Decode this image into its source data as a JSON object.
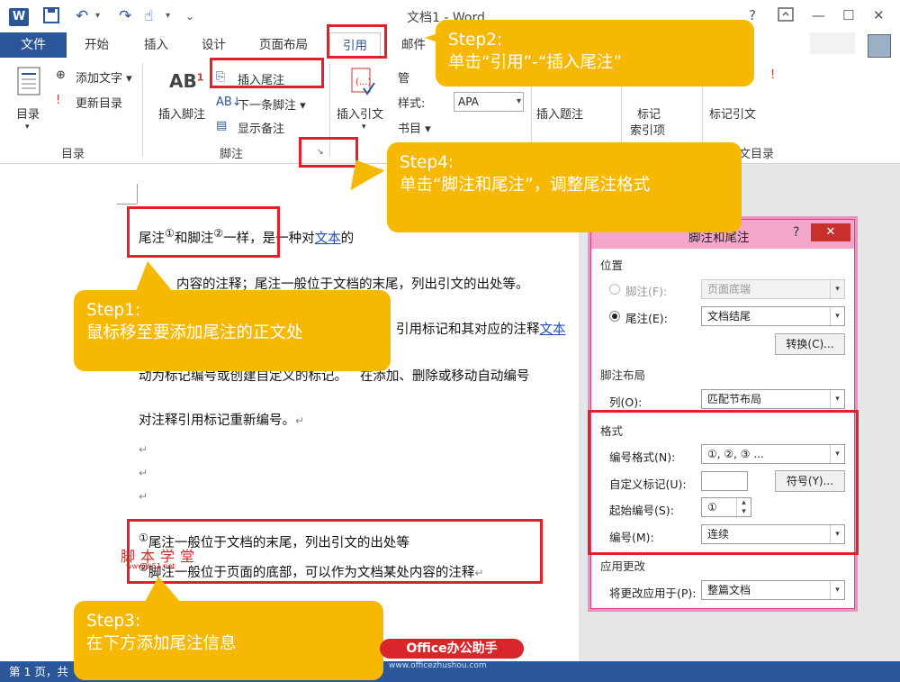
{
  "window": {
    "title": "文档1 - Word",
    "app_icon": "W",
    "qat_icons": [
      "save-icon",
      "undo-icon",
      "redo-icon",
      "touch-icon"
    ],
    "controls": [
      "help-icon",
      "ribbon-display-icon",
      "minimize-icon",
      "maximize-icon",
      "close-icon"
    ]
  },
  "tabs": {
    "file": "文件",
    "items": [
      "开始",
      "插入",
      "设计",
      "页面布局",
      "引用",
      "邮件"
    ],
    "active": "引用"
  },
  "ribbon": {
    "toc": {
      "big_button": "目录",
      "add_text": "添加文字",
      "update_toc": "更新目录",
      "group": "目录"
    },
    "footnotes": {
      "insert_footnote": "插入脚注",
      "insert_endnote": "插入尾注",
      "next_footnote": "下一条脚注",
      "show_notes": "显示备注",
      "group": "脚注"
    },
    "citations": {
      "insert_citation": "插入引文",
      "manage": "管",
      "style_label": "样式:",
      "style_value": "APA",
      "bibliography": "书目"
    },
    "captions": {
      "insert_caption": "插入题注"
    },
    "index": {
      "mark_entry": "标记",
      "mark_entry_line2": "索引项"
    },
    "toa": {
      "mark_citation": "标记引文",
      "group": "引文目录"
    }
  },
  "document": {
    "line1_a": "尾注",
    "line1_sup1": "①",
    "line1_b": "和脚注",
    "line1_sup2": "②",
    "line1_c": "一样，是一种对",
    "line1_link": "文本",
    "line1_d": "的",
    "line2": "内容的注释；尾注一般位于文档的末尾，列出引文的出处等。",
    "line3_a": "引用标记和其对应的注释",
    "line3_link": "文本",
    "line4_a": "动为标记编号或创建自定义的标记。",
    "line4_b": "在添加、删除或移动自动编号",
    "line5": "对注释引用标记重新编号。",
    "para_mark": "↵",
    "note1_mark": "①",
    "note1": "尾注一般位于文档的末尾，列出引文的出处等",
    "note2_mark": "②",
    "note2": "脚注一般位于页面的底部，可以作为文档某处内容的注释",
    "watermark": "脚本学堂",
    "watermark_url": "www.jb51.net"
  },
  "statusbar": {
    "page": "第 1 页，共"
  },
  "dialog": {
    "title": "脚注和尾注",
    "help": "?",
    "close": "✕",
    "location_section": "位置",
    "footnote_label": "脚注(F):",
    "footnote_value": "页面底端",
    "endnote_label": "尾注(E):",
    "endnote_value": "文档结尾",
    "convert_button": "转换(C)...",
    "layout_section": "脚注布局",
    "columns_label": "列(O):",
    "columns_value": "匹配节布局",
    "format_section": "格式",
    "number_format_label": "编号格式(N):",
    "number_format_value": "①, ②, ③ ...",
    "custom_mark_label": "自定义标记(U):",
    "custom_mark_value": "",
    "symbol_button": "符号(Y)...",
    "start_at_label": "起始编号(S):",
    "start_at_value": "①",
    "numbering_label": "编号(M):",
    "numbering_value": "连续",
    "apply_section": "应用更改",
    "apply_to_label": "将更改应用于(P):",
    "apply_to_value": "整篇文档"
  },
  "callouts": {
    "step1_title": "Step1:",
    "step1_text": "鼠标移至要添加尾注的正文处",
    "step2_title": "Step2:",
    "step2_text": "单击“引用”-“插入尾注”",
    "step3_title": "Step3:",
    "step3_text": "在下方添加尾注信息",
    "step4_title": "Step4:",
    "step4_text": "单击“脚注和尾注”，调整尾注格式"
  },
  "brand": {
    "badge": "Office办公助手",
    "url": "www.officezhushou.com"
  },
  "colors": {
    "word_blue": "#2b579a",
    "callout_yellow": "#f6b800",
    "highlight_red": "#e0202a",
    "dialog_pink": "#f3a6c9"
  }
}
